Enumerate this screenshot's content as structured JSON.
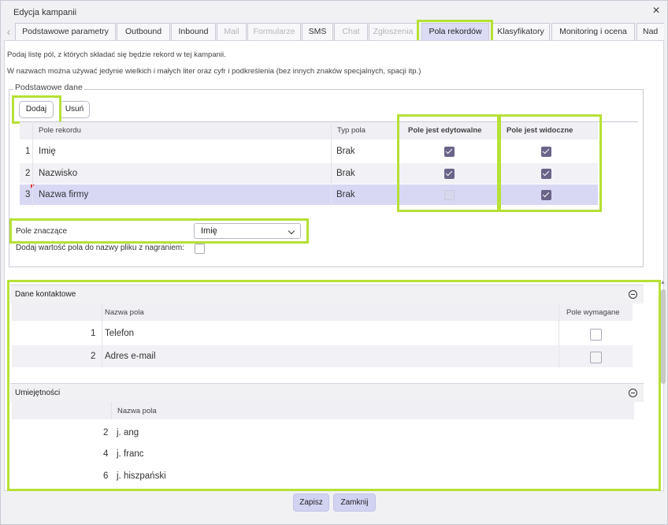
{
  "window": {
    "title": "Edycja kampanii"
  },
  "tabs": [
    {
      "label": "Podstawowe parametry",
      "state": "normal"
    },
    {
      "label": "Outbound",
      "state": "normal"
    },
    {
      "label": "Inbound",
      "state": "normal"
    },
    {
      "label": "Mail",
      "state": "disabled"
    },
    {
      "label": "Formularze",
      "state": "disabled"
    },
    {
      "label": "SMS",
      "state": "normal"
    },
    {
      "label": "Chat",
      "state": "disabled"
    },
    {
      "label": "Zgłoszenia",
      "state": "disabled"
    },
    {
      "label": "Pola rekordów",
      "state": "active"
    },
    {
      "label": "Klasyfikatory",
      "state": "normal"
    },
    {
      "label": "Monitoring i ocena",
      "state": "normal"
    },
    {
      "label": "Nad",
      "state": "normal"
    }
  ],
  "info": {
    "line1": "Podaj listę pól, z których składać się będzie rekord w tej kampanii.",
    "line2": "W nazwach można używać jedynie wielkich i małych liter oraz cyfr i podkreślenia (bez innych znaków specjalnych, spacji itp.)"
  },
  "basic": {
    "legend": "Podstawowe dane",
    "add_label": "Dodaj",
    "remove_label": "Usuń",
    "columns": {
      "field": "Pole rekordu",
      "type": "Typ pola",
      "editable": "Pole jest edytowalne",
      "visible": "Pole jest widoczne"
    },
    "rows": [
      {
        "num": "1",
        "field": "Imię",
        "type": "Brak",
        "editable": "checked",
        "visible": "checked"
      },
      {
        "num": "2",
        "field": "Nazwisko",
        "type": "Brak",
        "editable": "checked",
        "visible": "checked"
      },
      {
        "num": "3",
        "field": "Nazwa firmy",
        "type": "Brak",
        "editable": "disabled",
        "visible": "checked"
      }
    ],
    "key_field_label": "Pole znaczące",
    "key_field_value": "Imię",
    "append_label": "Dodaj wartość pola do nazwy pliku z nagraniem:"
  },
  "contact": {
    "title": "Dane kontaktowe",
    "columns": {
      "name": "Nazwa pola",
      "required": "Pole wymagane"
    },
    "rows": [
      {
        "num": "1",
        "name": "Telefon"
      },
      {
        "num": "2",
        "name": "Adres e-mail"
      }
    ]
  },
  "skills": {
    "title": "Umiejętności",
    "columns": {
      "name": "Nazwa pola"
    },
    "rows": [
      {
        "num": "2",
        "name": "j. ang"
      },
      {
        "num": "4",
        "name": "j. franc"
      },
      {
        "num": "6",
        "name": "j. hiszpański"
      }
    ]
  },
  "footer": {
    "save_label": "Zapisz",
    "close_label": "Zamknij"
  },
  "colors": {
    "highlight": "#b6e036",
    "accent": "#6b6489",
    "selected_row": "#d8d8f5"
  }
}
